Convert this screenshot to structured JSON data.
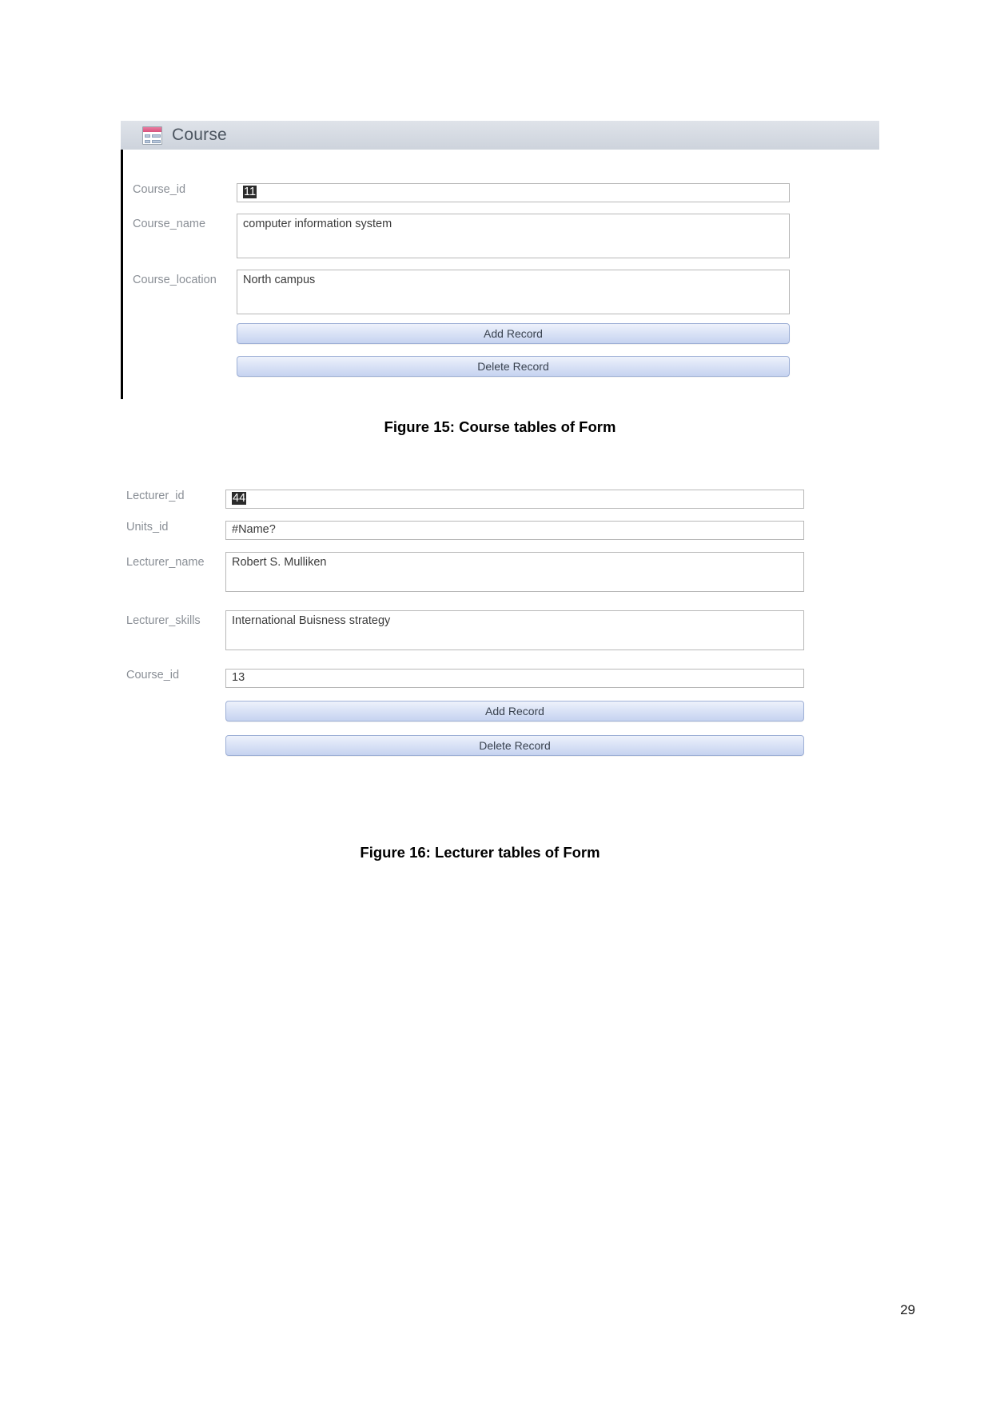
{
  "page": {
    "number": "29"
  },
  "figure15": {
    "caption": "Figure 15: Course tables of Form",
    "window": {
      "title": "Course",
      "icon": "access-form-icon"
    },
    "fields": [
      {
        "label": "Course_id",
        "value": "11",
        "selected": true
      },
      {
        "label": "Course_name",
        "value": "computer information system",
        "selected": false
      },
      {
        "label": "Course_location",
        "value": "North campus",
        "selected": false
      }
    ],
    "buttons": {
      "add": "Add Record",
      "delete": "Delete Record"
    }
  },
  "figure16": {
    "caption": "Figure 16: Lecturer tables of Form",
    "fields": [
      {
        "label": "Lecturer_id",
        "value": "44",
        "selected": true
      },
      {
        "label": "Units_id",
        "value": "#Name?",
        "selected": false
      },
      {
        "label": "Lecturer_name",
        "value": "Robert S. Mulliken",
        "selected": false
      },
      {
        "label": "Lecturer_skills",
        "value": "International Buisness strategy",
        "selected": false
      },
      {
        "label": "Course_id",
        "value": "13",
        "selected": false
      }
    ],
    "buttons": {
      "add": "Add Record",
      "delete": "Delete Record"
    }
  },
  "colors": {
    "titlebar": "#d6dbe3",
    "button_accent": "#c6d3f0",
    "icon_accent": "#d8537e",
    "label_text": "#8a8f96"
  }
}
